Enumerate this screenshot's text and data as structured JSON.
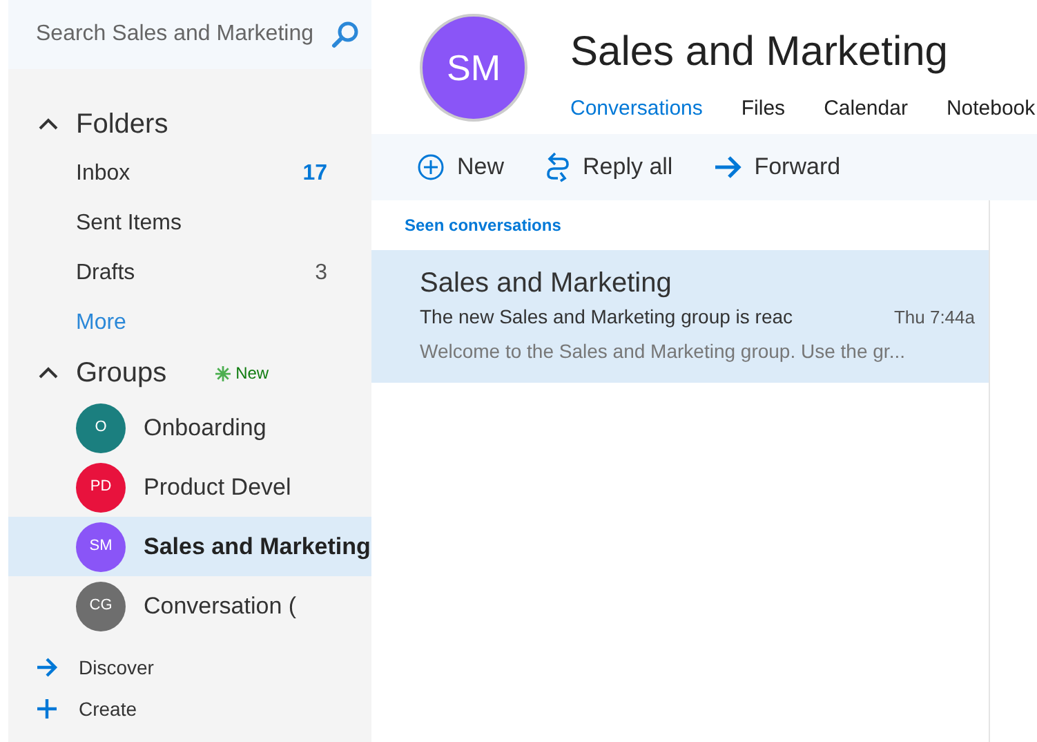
{
  "search": {
    "placeholder": "Search Sales and Marketing"
  },
  "folders": {
    "title": "Folders",
    "expanded": true,
    "items": [
      {
        "label": "Inbox",
        "count": "17",
        "unread": true
      },
      {
        "label": "Sent Items"
      },
      {
        "label": "Drafts",
        "count": "3",
        "unread": false
      }
    ],
    "more": "More"
  },
  "groups": {
    "title": "Groups",
    "expanded": true,
    "badge": "New",
    "items": [
      {
        "initials": "O",
        "label": "Onboarding",
        "color": "#1b7f7f",
        "selected": false
      },
      {
        "initials": "PD",
        "label": "Product Devel",
        "color": "#e8123d",
        "selected": false
      },
      {
        "initials": "SM",
        "label": "Sales and Marketing",
        "color": "#8a55f7",
        "selected": true
      },
      {
        "initials": "CG",
        "label": "Conversation (",
        "color": "#6e6e6e",
        "selected": false
      }
    ]
  },
  "sidebar_actions": [
    {
      "kind": "discover",
      "label": "Discover"
    },
    {
      "kind": "create",
      "label": "Create"
    }
  ],
  "header": {
    "initials": "SM",
    "color": "#8a55f7",
    "title": "Sales and Marketing"
  },
  "tabs": [
    {
      "label": "Conversations",
      "selected": true
    },
    {
      "label": "Files",
      "selected": false
    },
    {
      "label": "Calendar",
      "selected": false
    },
    {
      "label": "Notebook",
      "selected": false
    }
  ],
  "toolbar": [
    {
      "kind": "new",
      "label": "New"
    },
    {
      "kind": "reply_all",
      "label": "Reply all"
    },
    {
      "kind": "forward",
      "label": "Forward"
    }
  ],
  "list": {
    "section": "Seen conversations",
    "items": [
      {
        "sender": "Sales and Marketing",
        "subject": "The new Sales and Marketing group is reac",
        "time": "Thu 7:44a",
        "preview": "Welcome to the Sales and Marketing group. Use the gr...",
        "selected": true
      }
    ]
  }
}
